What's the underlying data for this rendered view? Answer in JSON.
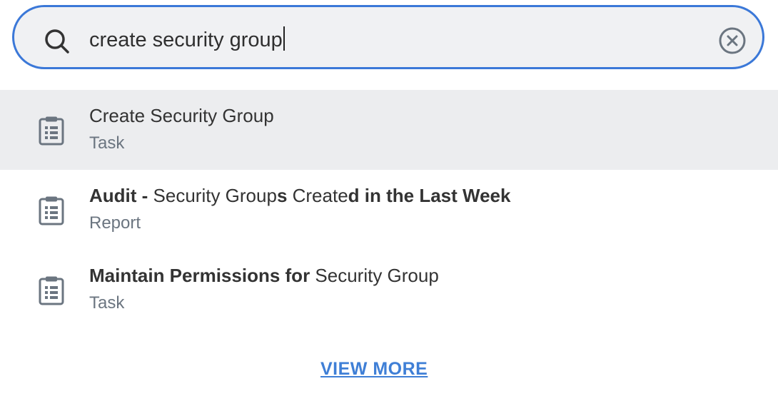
{
  "search": {
    "query": "create security group"
  },
  "results": [
    {
      "title_parts": [
        {
          "text": "Create Security Group",
          "bold": false
        }
      ],
      "type": "Task"
    },
    {
      "title_parts": [
        {
          "text": "Audit - ",
          "bold": true
        },
        {
          "text": "Security Group",
          "bold": false
        },
        {
          "text": "s ",
          "bold": true
        },
        {
          "text": "Create",
          "bold": false
        },
        {
          "text": "d in the Last Week",
          "bold": true
        }
      ],
      "type": "Report"
    },
    {
      "title_parts": [
        {
          "text": "Maintain Permissions for ",
          "bold": true
        },
        {
          "text": "Security Group",
          "bold": false
        }
      ],
      "type": "Task"
    }
  ],
  "footer": {
    "view_more_label": "VIEW MORE"
  },
  "colors": {
    "accent": "#3b78d8",
    "link": "#3f7fd6",
    "selected_bg": "#ecedef"
  }
}
